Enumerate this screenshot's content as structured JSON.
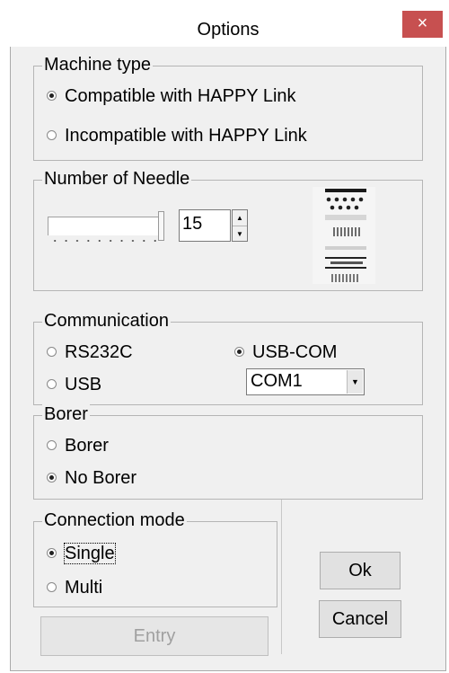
{
  "title": "Options",
  "close_glyph": "×",
  "machine_type": {
    "legend": "Machine type",
    "options": [
      {
        "label": "Compatible with HAPPY Link",
        "checked": true
      },
      {
        "label": "Incompatible with HAPPY Link",
        "checked": false
      }
    ]
  },
  "needle": {
    "legend": "Number of Needle",
    "value": "15",
    "icon": "needle-bar-icon"
  },
  "communication": {
    "legend": "Communication",
    "options": [
      {
        "label": "RS232C",
        "checked": false
      },
      {
        "label": "USB",
        "checked": false
      },
      {
        "label": "USB-COM",
        "checked": true
      }
    ],
    "port": "COM1"
  },
  "borer": {
    "legend": "Borer",
    "options": [
      {
        "label": "Borer",
        "checked": false
      },
      {
        "label": "No Borer",
        "checked": true
      }
    ]
  },
  "connection_mode": {
    "legend": "Connection mode",
    "options": [
      {
        "label": "Single",
        "checked": true
      },
      {
        "label": "Multi",
        "checked": false
      }
    ]
  },
  "buttons": {
    "entry": "Entry",
    "ok": "Ok",
    "cancel": "Cancel"
  },
  "colors": {
    "dialog_bg": "#f0f0f0",
    "close_button": "#c75050"
  }
}
